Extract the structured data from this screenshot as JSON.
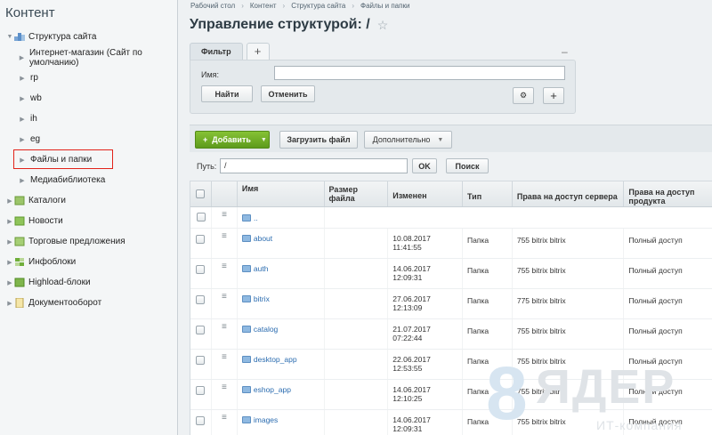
{
  "sidebar": {
    "title": "Контент",
    "items": [
      {
        "label": "Структура сайта",
        "level": 0,
        "expanded": true,
        "icon": "site-structure-icon"
      },
      {
        "label": "Интернет-магазин (Сайт по умолчанию)",
        "level": 1
      },
      {
        "label": "rp",
        "level": 1
      },
      {
        "label": "wb",
        "level": 1
      },
      {
        "label": "ih",
        "level": 1
      },
      {
        "label": "eg",
        "level": 1
      },
      {
        "label": "Файлы и папки",
        "level": 1,
        "active": true
      },
      {
        "label": "Медиабиблиотека",
        "level": 1
      },
      {
        "label": "Каталоги",
        "level": 0,
        "icon": "catalog-icon"
      },
      {
        "label": "Новости",
        "level": 0,
        "icon": "news-icon"
      },
      {
        "label": "Торговые предложения",
        "level": 0,
        "icon": "offers-icon"
      },
      {
        "label": "Инфоблоки",
        "level": 0,
        "icon": "iblocks-icon"
      },
      {
        "label": "Highload-блоки",
        "level": 0,
        "icon": "highload-icon"
      },
      {
        "label": "Документооборот",
        "level": 0,
        "icon": "docflow-icon"
      }
    ]
  },
  "breadcrumb": [
    "Рабочий стол",
    "Контент",
    "Структура сайта",
    "Файлы и папки"
  ],
  "page_title": "Управление структурой: /",
  "filter": {
    "tab_label": "Фильтр",
    "add_tab": "+",
    "collapse": "–",
    "name_label": "Имя:",
    "name_value": "",
    "find_label": "Найти",
    "cancel_label": "Отменить",
    "plus": "+"
  },
  "toolbar": {
    "add_label": "Добавить",
    "upload_label": "Загрузить файл",
    "more_label": "Дополнительно"
  },
  "path": {
    "label": "Путь:",
    "value": "/",
    "ok_label": "OK",
    "search_label": "Поиск"
  },
  "table": {
    "headers": {
      "name": "Имя",
      "size": "Размер файла",
      "modified": "Изменен",
      "type": "Тип",
      "server_rights": "Права на доступ сервера",
      "product_rights": "Права на доступ продукта"
    },
    "up_row": "..",
    "rows": [
      {
        "name": "about",
        "size": "",
        "date": "10.08.2017",
        "time": "11:41:55",
        "type": "Папка",
        "server": "755 bitrix bitrix",
        "product": "Полный доступ"
      },
      {
        "name": "auth",
        "size": "",
        "date": "14.06.2017",
        "time": "12:09:31",
        "type": "Папка",
        "server": "755 bitrix bitrix",
        "product": "Полный доступ"
      },
      {
        "name": "bitrix",
        "size": "",
        "date": "27.06.2017",
        "time": "12:13:09",
        "type": "Папка",
        "server": "775 bitrix bitrix",
        "product": "Полный доступ"
      },
      {
        "name": "catalog",
        "size": "",
        "date": "21.07.2017",
        "time": "07:22:44",
        "type": "Папка",
        "server": "755 bitrix bitrix",
        "product": "Полный доступ"
      },
      {
        "name": "desktop_app",
        "size": "",
        "date": "22.06.2017",
        "time": "12:53:55",
        "type": "Папка",
        "server": "755 bitrix bitrix",
        "product": "Полный доступ"
      },
      {
        "name": "eshop_app",
        "size": "",
        "date": "14.06.2017",
        "time": "12:10:25",
        "type": "Папка",
        "server": "755 bitrix bitrix",
        "product": "Полный доступ"
      },
      {
        "name": "images",
        "size": "",
        "date": "14.06.2017",
        "time": "12:09:31",
        "type": "Папка",
        "server": "755 bitrix bitrix",
        "product": "Полный доступ"
      }
    ]
  },
  "watermark": {
    "digit": "8",
    "brand": "ЯДЕР",
    "sub": "ИТ-компания"
  },
  "colors": {
    "accent_green": "#6aad24",
    "active_border": "#e2231a",
    "link": "#2b6cb0"
  }
}
